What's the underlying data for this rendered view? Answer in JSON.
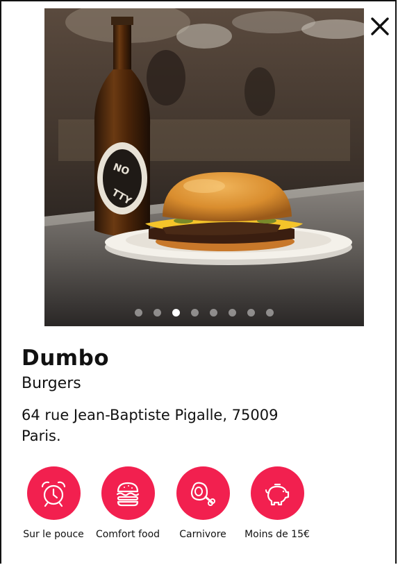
{
  "restaurant": {
    "name": "Dumbo",
    "category": "Burgers",
    "address": "64 rue Jean-Baptiste Pigalle, 75009 Paris."
  },
  "gallery": {
    "slide_count": 8,
    "active_index": 2
  },
  "tags": [
    {
      "label": "Sur le pouce",
      "icon": "alarm-clock-icon"
    },
    {
      "label": "Comfort food",
      "icon": "burger-icon"
    },
    {
      "label": "Carnivore",
      "icon": "meat-ham-icon"
    },
    {
      "label": "Moins de 15€",
      "icon": "piggy-bank-icon"
    }
  ],
  "colors": {
    "accent": "#f2204f"
  }
}
